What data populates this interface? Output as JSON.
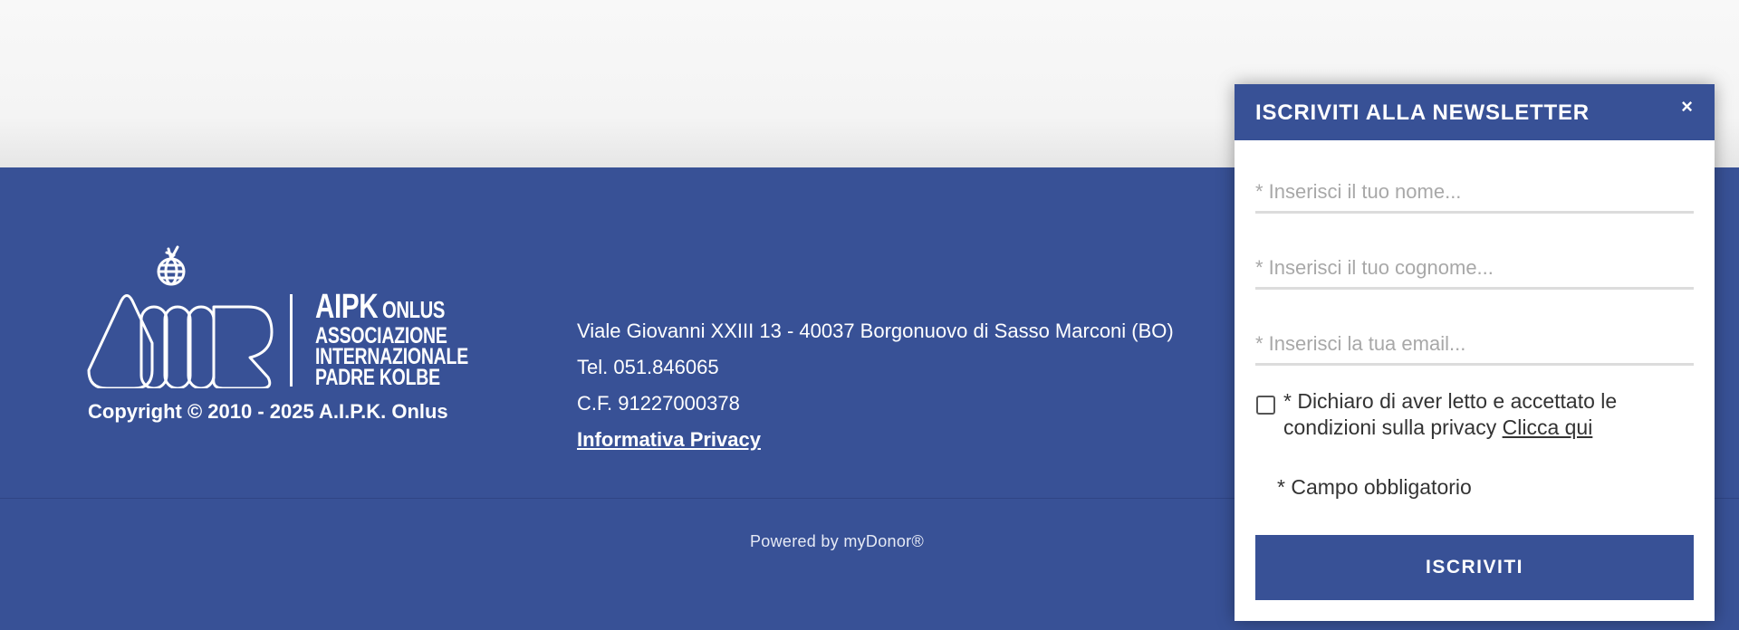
{
  "footer": {
    "logo": {
      "name": "AIPK",
      "onlus": "ONLUS",
      "line1": "ASSOCIAZIONE",
      "line2": "INTERNAZIONALE",
      "line3": "PADRE KOLBE"
    },
    "copyright": "Copyright © 2010 - 2025 A.I.P.K. Onlus",
    "address": "Viale Giovanni XXIII 13 - 40037 Borgonuovo di Sasso Marconi (BO)",
    "phone": "Tel. 051.846065",
    "tax_code": "C.F. 91227000378",
    "privacy_link": "Informativa Privacy",
    "powered_by": "Powered by myDonor®"
  },
  "newsletter": {
    "title": "ISCRIVITI ALLA NEWSLETTER",
    "close": "×",
    "name_placeholder": "* Inserisci il tuo nome...",
    "surname_placeholder": "* Inserisci il tuo cognome...",
    "email_placeholder": "* Inserisci la tua email...",
    "consent_text": "* Dichiaro di aver letto e accettato le condizioni sulla privacy",
    "consent_link": "Clicca qui",
    "required_note": "* Campo obbligatorio",
    "submit_label": "ISCRIVITI"
  },
  "colors": {
    "brand_blue": "#385196",
    "field_border": "#dcdcdc"
  }
}
